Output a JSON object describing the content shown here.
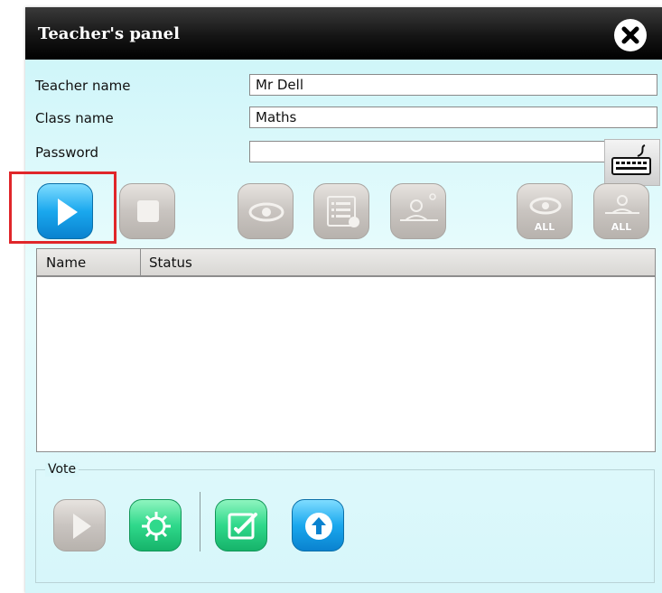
{
  "window": {
    "title": "Teacher's panel"
  },
  "form": {
    "teacher_name_label": "Teacher name",
    "teacher_name_value": "Mr Dell",
    "class_name_label": "Class name",
    "class_name_value": "Maths",
    "password_label": "Password",
    "password_value": ""
  },
  "toolbar": {
    "buttons": [
      {
        "name": "start",
        "icon": "play-icon",
        "state": "enabled",
        "highlighted": true
      },
      {
        "name": "stop",
        "icon": "stop-icon",
        "state": "disabled"
      },
      {
        "name": "view-student-screen",
        "icon": "eye-icon",
        "state": "disabled"
      },
      {
        "name": "show-teacher-screen",
        "icon": "screen-list-icon",
        "state": "disabled"
      },
      {
        "name": "lock-student",
        "icon": "user-lock-icon",
        "state": "disabled"
      },
      {
        "name": "view-all",
        "icon": "eye-all-icon",
        "state": "disabled",
        "badge": "ALL"
      },
      {
        "name": "lock-all",
        "icon": "user-all-icon",
        "state": "disabled",
        "badge": "ALL"
      }
    ]
  },
  "table": {
    "columns": [
      "Name",
      "Status"
    ],
    "rows": []
  },
  "vote": {
    "legend": "Vote",
    "buttons": [
      {
        "name": "vote-start",
        "icon": "play-icon",
        "state": "disabled"
      },
      {
        "name": "vote-settings",
        "icon": "gear-icon",
        "state": "enabled"
      },
      {
        "name": "vote-edit",
        "icon": "edit-icon",
        "state": "enabled"
      },
      {
        "name": "vote-upload",
        "icon": "upload-icon",
        "state": "enabled"
      }
    ]
  },
  "colors": {
    "accent_blue": "#1aa8ee",
    "accent_green": "#2fd98b",
    "highlight_red": "#e0262a"
  }
}
